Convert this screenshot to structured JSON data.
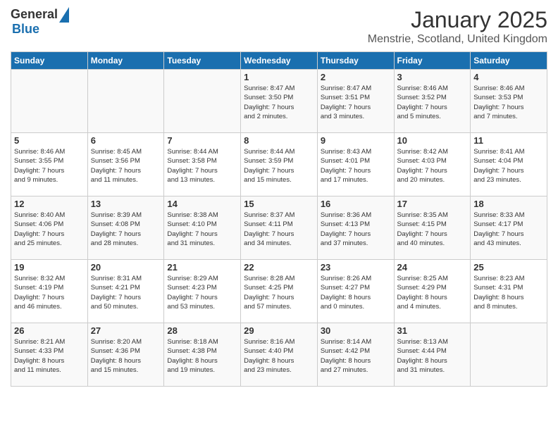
{
  "header": {
    "logo_general": "General",
    "logo_blue": "Blue",
    "main_title": "January 2025",
    "subtitle": "Menstrie, Scotland, United Kingdom"
  },
  "days_of_week": [
    "Sunday",
    "Monday",
    "Tuesday",
    "Wednesday",
    "Thursday",
    "Friday",
    "Saturday"
  ],
  "weeks": [
    [
      {
        "day": "",
        "info": ""
      },
      {
        "day": "",
        "info": ""
      },
      {
        "day": "",
        "info": ""
      },
      {
        "day": "1",
        "info": "Sunrise: 8:47 AM\nSunset: 3:50 PM\nDaylight: 7 hours\nand 2 minutes."
      },
      {
        "day": "2",
        "info": "Sunrise: 8:47 AM\nSunset: 3:51 PM\nDaylight: 7 hours\nand 3 minutes."
      },
      {
        "day": "3",
        "info": "Sunrise: 8:46 AM\nSunset: 3:52 PM\nDaylight: 7 hours\nand 5 minutes."
      },
      {
        "day": "4",
        "info": "Sunrise: 8:46 AM\nSunset: 3:53 PM\nDaylight: 7 hours\nand 7 minutes."
      }
    ],
    [
      {
        "day": "5",
        "info": "Sunrise: 8:46 AM\nSunset: 3:55 PM\nDaylight: 7 hours\nand 9 minutes."
      },
      {
        "day": "6",
        "info": "Sunrise: 8:45 AM\nSunset: 3:56 PM\nDaylight: 7 hours\nand 11 minutes."
      },
      {
        "day": "7",
        "info": "Sunrise: 8:44 AM\nSunset: 3:58 PM\nDaylight: 7 hours\nand 13 minutes."
      },
      {
        "day": "8",
        "info": "Sunrise: 8:44 AM\nSunset: 3:59 PM\nDaylight: 7 hours\nand 15 minutes."
      },
      {
        "day": "9",
        "info": "Sunrise: 8:43 AM\nSunset: 4:01 PM\nDaylight: 7 hours\nand 17 minutes."
      },
      {
        "day": "10",
        "info": "Sunrise: 8:42 AM\nSunset: 4:03 PM\nDaylight: 7 hours\nand 20 minutes."
      },
      {
        "day": "11",
        "info": "Sunrise: 8:41 AM\nSunset: 4:04 PM\nDaylight: 7 hours\nand 23 minutes."
      }
    ],
    [
      {
        "day": "12",
        "info": "Sunrise: 8:40 AM\nSunset: 4:06 PM\nDaylight: 7 hours\nand 25 minutes."
      },
      {
        "day": "13",
        "info": "Sunrise: 8:39 AM\nSunset: 4:08 PM\nDaylight: 7 hours\nand 28 minutes."
      },
      {
        "day": "14",
        "info": "Sunrise: 8:38 AM\nSunset: 4:10 PM\nDaylight: 7 hours\nand 31 minutes."
      },
      {
        "day": "15",
        "info": "Sunrise: 8:37 AM\nSunset: 4:11 PM\nDaylight: 7 hours\nand 34 minutes."
      },
      {
        "day": "16",
        "info": "Sunrise: 8:36 AM\nSunset: 4:13 PM\nDaylight: 7 hours\nand 37 minutes."
      },
      {
        "day": "17",
        "info": "Sunrise: 8:35 AM\nSunset: 4:15 PM\nDaylight: 7 hours\nand 40 minutes."
      },
      {
        "day": "18",
        "info": "Sunrise: 8:33 AM\nSunset: 4:17 PM\nDaylight: 7 hours\nand 43 minutes."
      }
    ],
    [
      {
        "day": "19",
        "info": "Sunrise: 8:32 AM\nSunset: 4:19 PM\nDaylight: 7 hours\nand 46 minutes."
      },
      {
        "day": "20",
        "info": "Sunrise: 8:31 AM\nSunset: 4:21 PM\nDaylight: 7 hours\nand 50 minutes."
      },
      {
        "day": "21",
        "info": "Sunrise: 8:29 AM\nSunset: 4:23 PM\nDaylight: 7 hours\nand 53 minutes."
      },
      {
        "day": "22",
        "info": "Sunrise: 8:28 AM\nSunset: 4:25 PM\nDaylight: 7 hours\nand 57 minutes."
      },
      {
        "day": "23",
        "info": "Sunrise: 8:26 AM\nSunset: 4:27 PM\nDaylight: 8 hours\nand 0 minutes."
      },
      {
        "day": "24",
        "info": "Sunrise: 8:25 AM\nSunset: 4:29 PM\nDaylight: 8 hours\nand 4 minutes."
      },
      {
        "day": "25",
        "info": "Sunrise: 8:23 AM\nSunset: 4:31 PM\nDaylight: 8 hours\nand 8 minutes."
      }
    ],
    [
      {
        "day": "26",
        "info": "Sunrise: 8:21 AM\nSunset: 4:33 PM\nDaylight: 8 hours\nand 11 minutes."
      },
      {
        "day": "27",
        "info": "Sunrise: 8:20 AM\nSunset: 4:36 PM\nDaylight: 8 hours\nand 15 minutes."
      },
      {
        "day": "28",
        "info": "Sunrise: 8:18 AM\nSunset: 4:38 PM\nDaylight: 8 hours\nand 19 minutes."
      },
      {
        "day": "29",
        "info": "Sunrise: 8:16 AM\nSunset: 4:40 PM\nDaylight: 8 hours\nand 23 minutes."
      },
      {
        "day": "30",
        "info": "Sunrise: 8:14 AM\nSunset: 4:42 PM\nDaylight: 8 hours\nand 27 minutes."
      },
      {
        "day": "31",
        "info": "Sunrise: 8:13 AM\nSunset: 4:44 PM\nDaylight: 8 hours\nand 31 minutes."
      },
      {
        "day": "",
        "info": ""
      }
    ]
  ]
}
